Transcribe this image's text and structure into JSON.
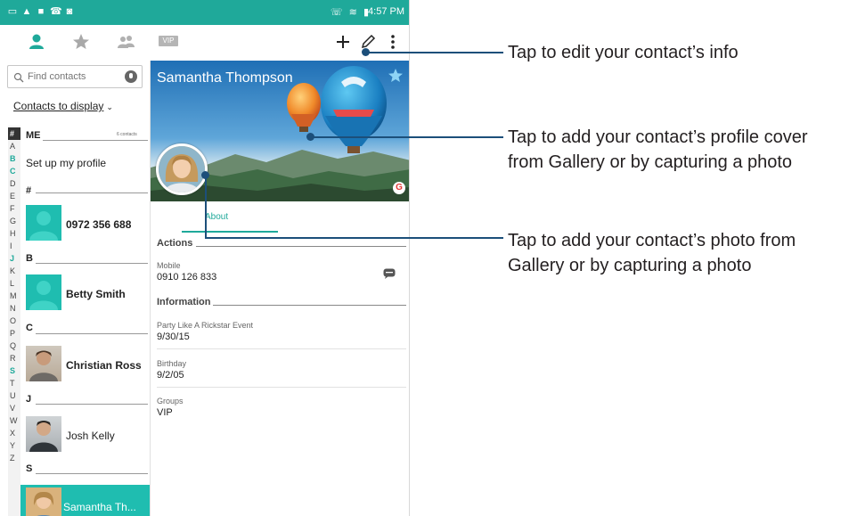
{
  "status_bar": {
    "left_icons": [
      "sim-icon",
      "alert-icon",
      "bbm-icon",
      "phone-icon",
      "photo-icon"
    ],
    "right_icons": [
      "call-icon",
      "wifi-icon",
      "battery-icon"
    ],
    "time": "4:57 PM"
  },
  "toolbar": {
    "tabs": [
      "contacts-tab-icon",
      "favorites-tab-icon",
      "groups-tab-icon"
    ],
    "vip_label": "VIP",
    "actions": [
      "add-icon",
      "edit-icon",
      "more-icon"
    ]
  },
  "contact_list": {
    "search_placeholder": "Find contacts",
    "filter_label": "Contacts to display",
    "alphabet": [
      "#",
      "A",
      "B",
      "C",
      "D",
      "E",
      "F",
      "G",
      "H",
      "I",
      "J",
      "K",
      "L",
      "M",
      "N",
      "O",
      "P",
      "Q",
      "R",
      "S",
      "T",
      "U",
      "V",
      "W",
      "X",
      "Y",
      "Z"
    ],
    "sections": {
      "me": {
        "header": "ME",
        "count": "6 contacts",
        "row": "Set up my profile"
      },
      "hash": {
        "header": "#",
        "row": "0972 356 688"
      },
      "b": {
        "header": "B",
        "row": "Betty Smith"
      },
      "c": {
        "header": "C",
        "row": "Christian Ross"
      },
      "j": {
        "header": "J",
        "row": "Josh Kelly"
      },
      "s": {
        "header": "S",
        "row": "Samantha Th..."
      }
    }
  },
  "detail": {
    "name": "Samantha Thompson",
    "tab": "About",
    "actions_header": "Actions",
    "mobile_label": "Mobile",
    "mobile_value": "0910 126 833",
    "info_header": "Information",
    "event_label": "Party Like A Rickstar Event",
    "event_value": "9/30/15",
    "birthday_label": "Birthday",
    "birthday_value": "9/2/05",
    "groups_label": "Groups",
    "groups_value": "VIP"
  },
  "callouts": {
    "edit": "Tap to edit your contact’s info",
    "cover_line1": "Tap to add your contact’s profile cover",
    "cover_line2": "from Gallery or by capturing a photo",
    "photo_line1": "Tap to add your contact’s photo from",
    "photo_line2": "Gallery or by capturing a photo"
  },
  "colors": {
    "accent": "#1fa99a",
    "callout": "#1c4f7a"
  }
}
